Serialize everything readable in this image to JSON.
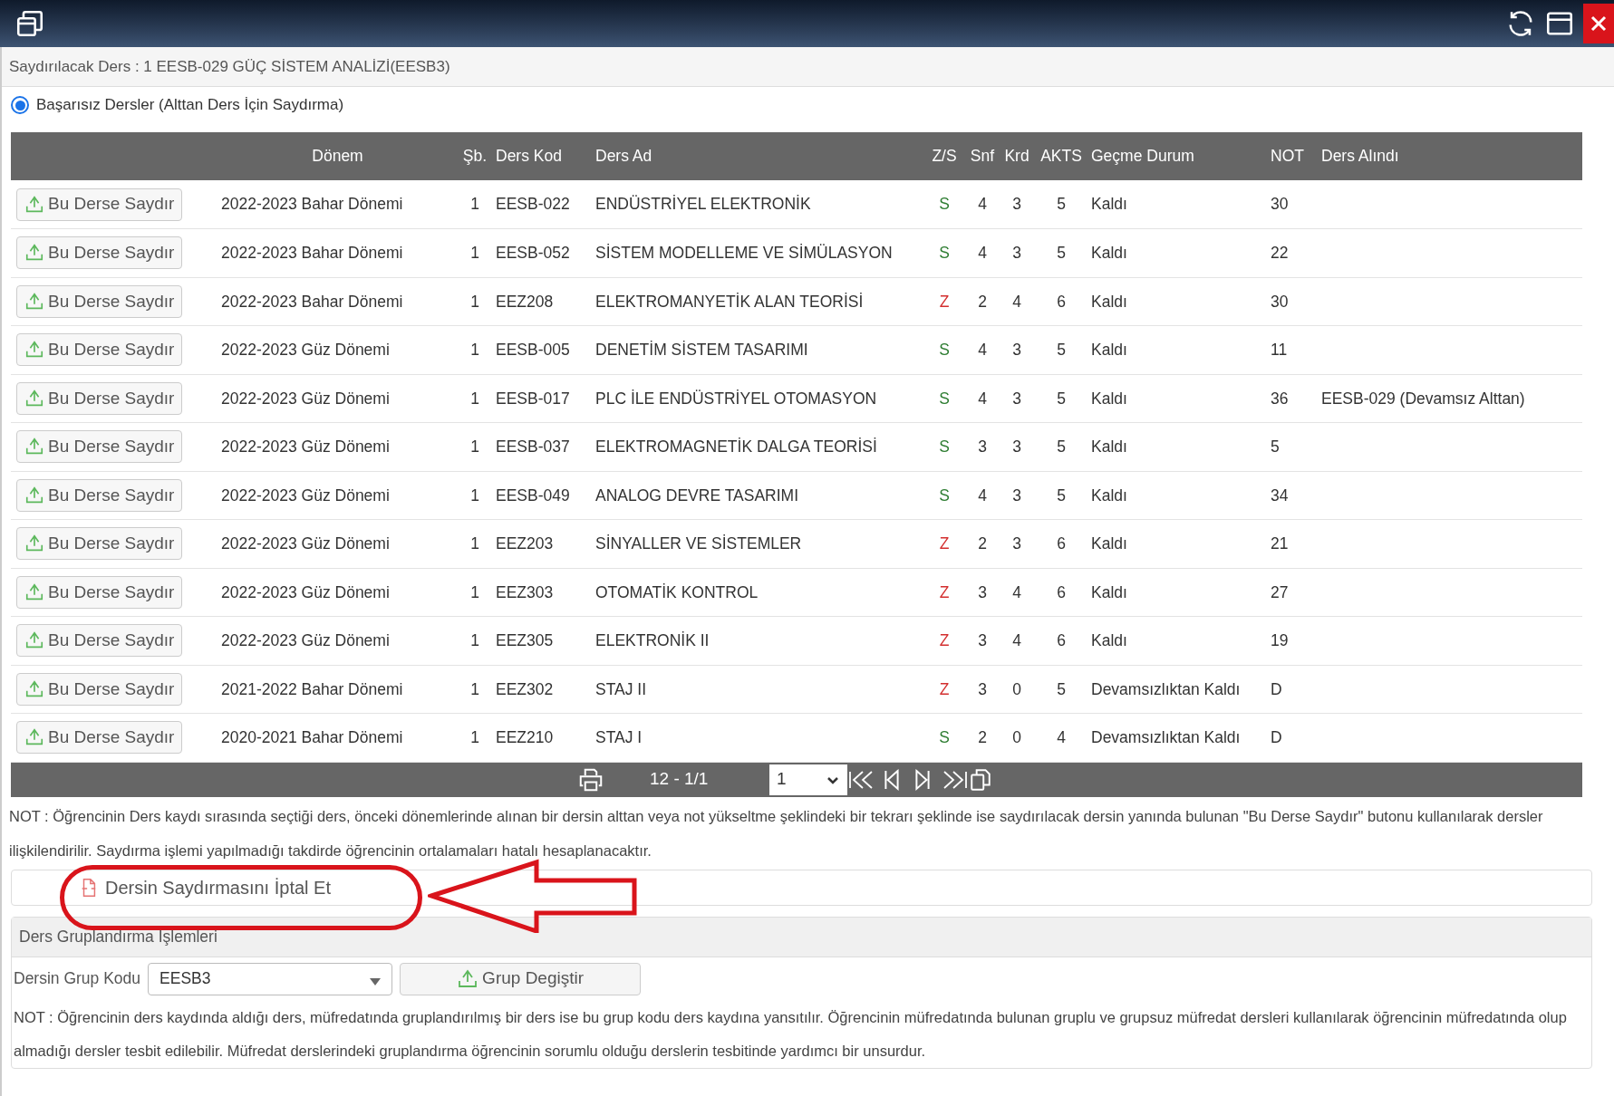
{
  "info": "Saydırılacak Ders : 1 EESB-029 GÜÇ SİSTEM ANALİZİ(EESB3)",
  "radio": {
    "label": "Başarısız Dersler (Alttan Ders İçin Saydırma)",
    "selected": true
  },
  "table": {
    "columns": [
      "Dönem",
      "Şb.",
      "Ders Kod",
      "Ders Ad",
      "Z/S",
      "Snf",
      "Krd",
      "AKTS",
      "Geçme Durum",
      "NOT",
      "Ders Alındı"
    ],
    "rows": [
      {
        "button": "Bu Derse Saydır",
        "donem": "2022-2023 Bahar Dönemi",
        "sb": "1",
        "kod": "EESB-022",
        "ad": "ENDÜSTRİYEL ELEKTRONİK",
        "zs": "S",
        "color": "#2e7d32",
        "snf": "4",
        "krd": "3",
        "akts": "5",
        "durum": "Kaldı",
        "not": "30"
      },
      {
        "button": "Bu Derse Saydır",
        "donem": "2022-2023 Bahar Dönemi",
        "sb": "1",
        "kod": "EESB-052",
        "ad": "SİSTEM MODELLEME VE SİMÜLASYON",
        "zs": "S",
        "color": "#2e7d32",
        "snf": "4",
        "krd": "3",
        "akts": "5",
        "durum": "Kaldı",
        "not": "22"
      },
      {
        "button": "Bu Derse Saydır",
        "donem": "2022-2023 Bahar Dönemi",
        "sb": "1",
        "kod": "EEZ208",
        "ad": "ELEKTROMANYETİK ALAN TEORİSİ",
        "zs": "Z",
        "color": "#d32f2f",
        "snf": "2",
        "krd": "4",
        "akts": "6",
        "durum": "Kaldı",
        "not": "30"
      },
      {
        "button": "Bu Derse Saydır",
        "donem": "2022-2023 Güz Dönemi",
        "sb": "1",
        "kod": "EESB-005",
        "ad": "DENETİM SİSTEM TASARIMI",
        "zs": "S",
        "color": "#2e7d32",
        "snf": "4",
        "krd": "3",
        "akts": "5",
        "durum": "Kaldı",
        "not": "11"
      },
      {
        "button": "Bu Derse Saydır",
        "donem": "2022-2023 Güz Dönemi",
        "sb": "1",
        "kod": "EESB-017",
        "ad": "PLC İLE ENDÜSTRİYEL OTOMASYON",
        "zs": "S",
        "color": "#2e7d32",
        "snf": "4",
        "krd": "3",
        "akts": "5",
        "durum": "Kaldı",
        "not": "36",
        "alindi": "EESB-029 (Devamsız Alttan)"
      },
      {
        "button": "Bu Derse Saydır",
        "donem": "2022-2023 Güz Dönemi",
        "sb": "1",
        "kod": "EESB-037",
        "ad": "ELEKTROMAGNETİK DALGA TEORİSİ",
        "zs": "S",
        "color": "#2e7d32",
        "snf": "3",
        "krd": "3",
        "akts": "5",
        "durum": "Kaldı",
        "not": "5"
      },
      {
        "button": "Bu Derse Saydır",
        "donem": "2022-2023 Güz Dönemi",
        "sb": "1",
        "kod": "EESB-049",
        "ad": "ANALOG DEVRE TASARIMI",
        "zs": "S",
        "color": "#2e7d32",
        "snf": "4",
        "krd": "3",
        "akts": "5",
        "durum": "Kaldı",
        "not": "34"
      },
      {
        "button": "Bu Derse Saydır",
        "donem": "2022-2023 Güz Dönemi",
        "sb": "1",
        "kod": "EEZ203",
        "ad": "SİNYALLER VE SİSTEMLER",
        "zs": "Z",
        "color": "#d32f2f",
        "snf": "2",
        "krd": "3",
        "akts": "6",
        "durum": "Kaldı",
        "not": "21"
      },
      {
        "button": "Bu Derse Saydır",
        "donem": "2022-2023 Güz Dönemi",
        "sb": "1",
        "kod": "EEZ303",
        "ad": "OTOMATİK KONTROL",
        "zs": "Z",
        "color": "#d32f2f",
        "snf": "3",
        "krd": "4",
        "akts": "6",
        "durum": "Kaldı",
        "not": "27"
      },
      {
        "button": "Bu Derse Saydır",
        "donem": "2022-2023 Güz Dönemi",
        "sb": "1",
        "kod": "EEZ305",
        "ad": "ELEKTRONİK II",
        "zs": "Z",
        "color": "#d32f2f",
        "snf": "3",
        "krd": "4",
        "akts": "6",
        "durum": "Kaldı",
        "not": "19"
      },
      {
        "button": "Bu Derse Saydır",
        "donem": "2021-2022 Bahar Dönemi",
        "sb": "1",
        "kod": "EEZ302",
        "ad": "STAJ II",
        "zs": "Z",
        "color": "#d32f2f",
        "snf": "3",
        "krd": "0",
        "akts": "5",
        "durum": "Devamsızlıktan Kaldı",
        "not": "D"
      },
      {
        "button": "Bu Derse Saydır",
        "donem": "2020-2021 Bahar Dönemi",
        "sb": "1",
        "kod": "EEZ210",
        "ad": "STAJ I",
        "zs": "S",
        "color": "#2e7d32",
        "snf": "2",
        "krd": "0",
        "akts": "4",
        "durum": "Devamsızlıktan Kaldı",
        "not": "D"
      }
    ]
  },
  "pager": {
    "summary": "12 - 1/1",
    "page": "1"
  },
  "note1": "NOT : Öğrencinin Ders kaydı sırasında seçtiği ders, önceki dönemlerinde alınan bir dersin alttan veya not yükseltme şeklindeki bir  tekrarı şeklinde ise saydırılacak dersin yanında bulunan \"Bu Derse Saydır\" butonu kullanılarak dersler ilişkilendirilir. Saydırma işlemi yapılmadığı takdirde öğrencinin ortalamaları hatalı hesaplanacaktır.",
  "cancel_button": "Dersin Saydırmasını İptal Et",
  "group_section": {
    "title": "Ders Gruplandırma İşlemleri",
    "label": "Dersin Grup Kodu",
    "value": "EESB3",
    "button": "Grup Degiştir",
    "note": "NOT : Öğrencinin ders kaydında aldığı ders, müfredatında  gruplandırılmış bir ders ise bu grup kodu ders kaydına yansıtılır. Öğrencinin müfredatında bulunan gruplu ve grupsuz müfredat dersleri kullanılarak öğrencinin müfredatında olup almadığı dersler tesbit edilebilir. Müfredat derslerindeki gruplandırma öğrencinin sorumlu olduğu derslerin tesbitinde yardımcı bir unsurdur."
  }
}
